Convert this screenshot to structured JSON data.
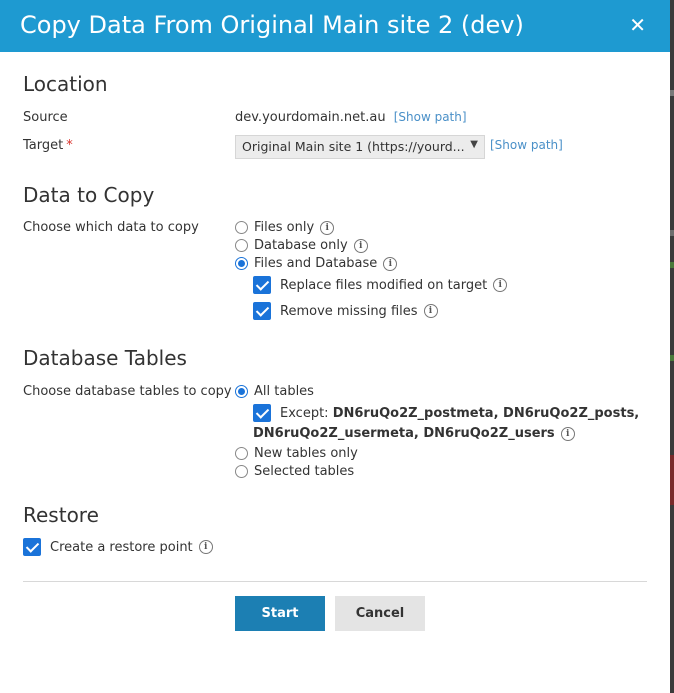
{
  "dialog": {
    "title": "Copy Data From Original Main site 2 (dev)",
    "close_glyph": "✕"
  },
  "location": {
    "heading": "Location",
    "source_label": "Source",
    "source_value": "dev.yourdomain.net.au",
    "show_path": "[Show path]",
    "target_label": "Target",
    "required_mark": "*",
    "target_value": "Original Main site 1 (https://yourd...",
    "target_show_path": "[Show path]"
  },
  "data_to_copy": {
    "heading": "Data to Copy",
    "label": "Choose which data to copy",
    "options": [
      {
        "label": "Files only",
        "selected": false
      },
      {
        "label": "Database only",
        "selected": false
      },
      {
        "label": "Files and Database",
        "selected": true
      }
    ],
    "sub_options": [
      {
        "label": "Replace files modified on target",
        "checked": true
      },
      {
        "label": "Remove missing files",
        "checked": true
      }
    ]
  },
  "database_tables": {
    "heading": "Database Tables",
    "label": "Choose database tables to copy",
    "all_tables": "All tables",
    "except_prefix": "Except:",
    "except_tables_line1": "DN6ruQo2Z_postmeta, DN6ruQo2Z_posts,",
    "except_tables_line2": "DN6ruQo2Z_usermeta, DN6ruQo2Z_users",
    "new_tables": "New tables only",
    "selected_tables": "Selected tables"
  },
  "restore": {
    "heading": "Restore",
    "checkbox_label": "Create a restore point",
    "checked": true
  },
  "buttons": {
    "start": "Start",
    "cancel": "Cancel"
  },
  "icons": {
    "info": "i",
    "chevron": "▼"
  },
  "colors": {
    "header": "#1e9ad1",
    "accent": "#1a73d9",
    "primary_button": "#1c7fb3",
    "link": "#4a90c8"
  }
}
